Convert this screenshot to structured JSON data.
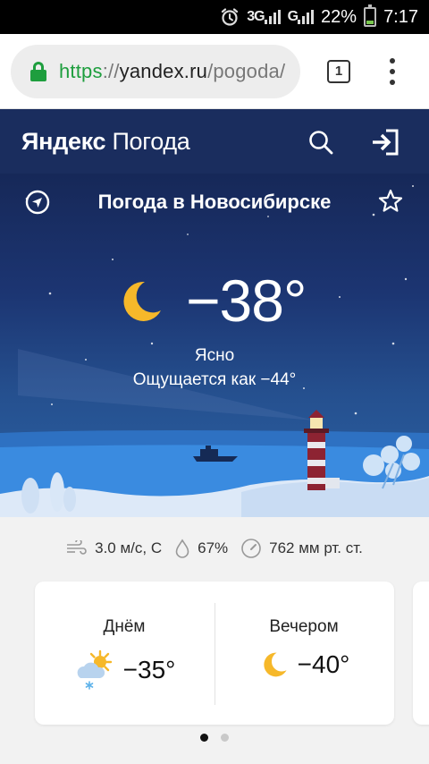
{
  "status_bar": {
    "signal_1": "3G",
    "signal_2": "G",
    "battery_percent": "22%",
    "battery_level": 0.22,
    "time": "7:17",
    "alarm_icon": "alarm-icon"
  },
  "browser": {
    "url_scheme": "https",
    "url_sep": "://",
    "url_host": "yandex.ru",
    "url_path": "/pogoda/",
    "tab_count": "1",
    "secure_color": "#1e9e3e"
  },
  "app": {
    "logo_bold": "Яндекс",
    "logo_light": "Погода",
    "header_color": "#1a2d5e"
  },
  "weather": {
    "title": "Погода в Новосибирске",
    "temperature": "−38°",
    "condition": "Ясно",
    "feels_like": "Ощущается как −44°",
    "icon": "moon-icon"
  },
  "details": {
    "wind": "3.0 м/с, С",
    "humidity": "67%",
    "pressure": "762 мм рт. ст."
  },
  "forecast": {
    "day": {
      "label": "Днём",
      "temp": "−35°",
      "icon": "partly-cloudy-snow-icon"
    },
    "evening": {
      "label": "Вечером",
      "temp": "−40°",
      "icon": "moon-icon"
    }
  },
  "pager": {
    "pages": 2,
    "active": 0
  }
}
